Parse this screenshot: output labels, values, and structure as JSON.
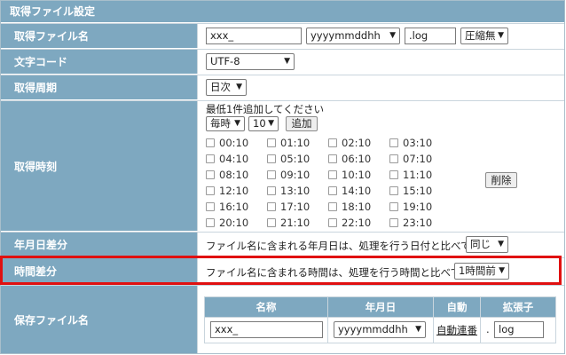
{
  "section_title": "取得ファイル設定",
  "file_name_row": {
    "label": "取得ファイル名",
    "prefix_value": "xxx_",
    "date_format": "yyyymmddhh",
    "extension_value": ".log",
    "compression": "圧縮無"
  },
  "encoding_row": {
    "label": "文字コード",
    "value": "UTF-8"
  },
  "period_row": {
    "label": "取得周期",
    "value": "日次"
  },
  "times_row": {
    "label": "取得時刻",
    "instruction": "最低1件追加してください",
    "interval": "毎時",
    "minute": "10",
    "add_button": "追加",
    "delete_button": "削除",
    "times": [
      [
        "00:10",
        "01:10",
        "02:10",
        "03:10"
      ],
      [
        "04:10",
        "05:10",
        "06:10",
        "07:10"
      ],
      [
        "08:10",
        "09:10",
        "10:10",
        "11:10"
      ],
      [
        "12:10",
        "13:10",
        "14:10",
        "15:10"
      ],
      [
        "16:10",
        "17:10",
        "18:10",
        "19:10"
      ],
      [
        "20:10",
        "21:10",
        "22:10",
        "23:10"
      ]
    ]
  },
  "date_diff_row": {
    "label": "年月日差分",
    "text": "ファイル名に含まれる年月日は、処理を行う日付と比べて",
    "value": "同じ"
  },
  "time_diff_row": {
    "label": "時間差分",
    "text": "ファイル名に含まれる時間は、処理を行う時間と比べて",
    "value": "1時間前"
  },
  "save_row": {
    "label": "保存ファイル名",
    "headers": {
      "name": "名称",
      "date": "年月日",
      "auto": "自動",
      "ext": "拡張子"
    },
    "name_value": "xxx_",
    "date_format": "yyyymmddhh",
    "auto_link": "自動連番",
    "dot": ".",
    "ext_value": "log"
  }
}
